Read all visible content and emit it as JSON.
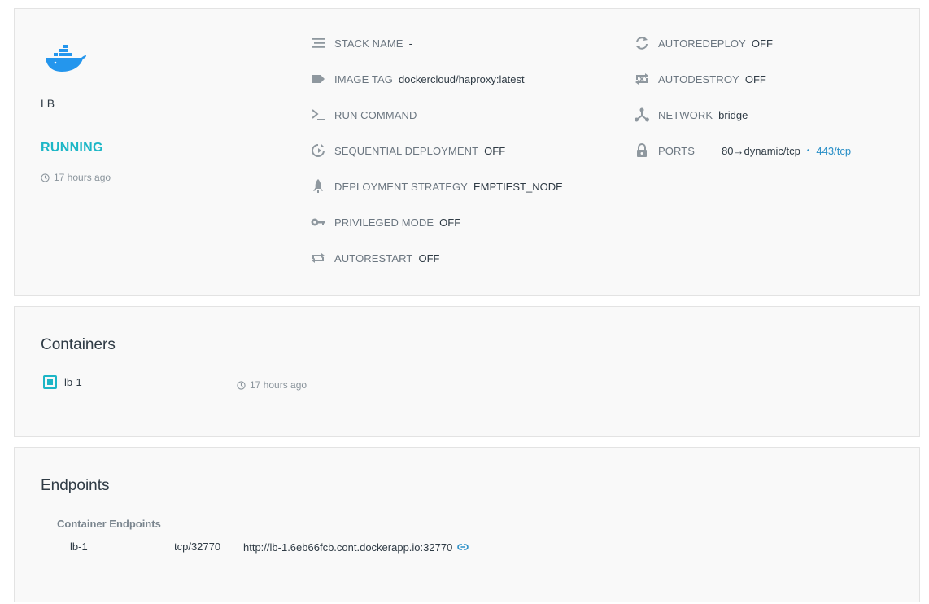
{
  "service": {
    "name": "LB",
    "status": "RUNNING",
    "status_color": "#1cb6c6",
    "updated": "17 hours ago"
  },
  "details_col1": [
    {
      "icon": "lines-icon",
      "label": "STACK NAME",
      "value": "-"
    },
    {
      "icon": "tag-icon",
      "label": "IMAGE TAG",
      "value": "dockercloud/haproxy:latest"
    },
    {
      "icon": "terminal-icon",
      "label": "RUN COMMAND",
      "value": ""
    },
    {
      "icon": "sequential-icon",
      "label": "SEQUENTIAL DEPLOYMENT",
      "value": "OFF"
    },
    {
      "icon": "rocket-icon",
      "label": "DEPLOYMENT STRATEGY",
      "value": "EMPTIEST_NODE"
    },
    {
      "icon": "key-icon",
      "label": "PRIVILEGED MODE",
      "value": "OFF"
    },
    {
      "icon": "repeat-icon",
      "label": "AUTORESTART",
      "value": "OFF"
    }
  ],
  "details_col2": [
    {
      "icon": "refresh-icon",
      "label": "AUTOREDEPLOY",
      "value": "OFF"
    },
    {
      "icon": "autodestroy-icon",
      "label": "AUTODESTROY",
      "value": "OFF"
    },
    {
      "icon": "network-icon",
      "label": "NETWORK",
      "value": "bridge"
    },
    {
      "icon": "lock-icon",
      "label": "PORTS",
      "value": "80→dynamic/tcp",
      "extra": "443/tcp",
      "separator": "•"
    }
  ],
  "containers": {
    "title": "Containers",
    "items": [
      {
        "name": "lb-1",
        "time": "17 hours ago"
      }
    ]
  },
  "endpoints": {
    "title": "Endpoints",
    "subtitle": "Container Endpoints",
    "rows": [
      {
        "container": "lb-1",
        "port": "tcp/32770",
        "url": "http://lb-1.6eb66fcb.cont.dockerapp.io:32770"
      }
    ]
  },
  "colors": {
    "accent": "#1cb6c6",
    "link": "#2a8fc7"
  }
}
